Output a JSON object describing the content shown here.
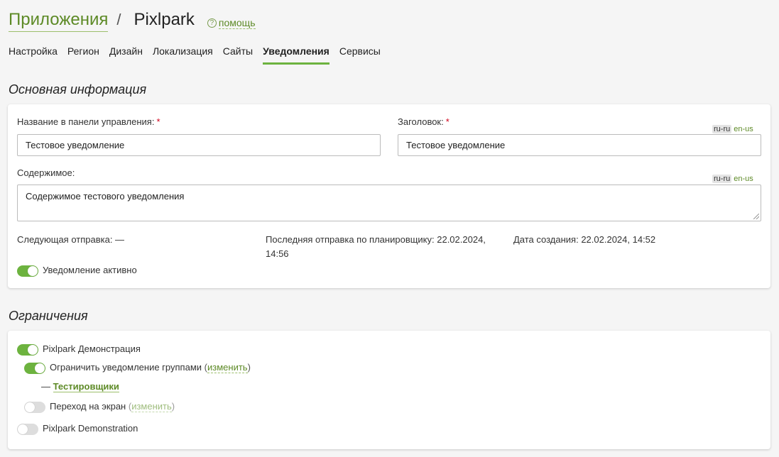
{
  "header": {
    "app_link": "Приложения",
    "separator": "/",
    "current": "Pixlpark",
    "help_icon_glyph": "?",
    "help_label": "помощь"
  },
  "tabs": [
    {
      "label": "Настройка",
      "active": false
    },
    {
      "label": "Регион",
      "active": false
    },
    {
      "label": "Дизайн",
      "active": false
    },
    {
      "label": "Локализация",
      "active": false
    },
    {
      "label": "Сайты",
      "active": false
    },
    {
      "label": "Уведомления",
      "active": true
    },
    {
      "label": "Сервисы",
      "active": false
    }
  ],
  "basic": {
    "section_title": "Основная информация",
    "name_label": "Название в панели управления:",
    "name_value": "Тестовое уведомление",
    "title_label": "Заголовок:",
    "title_value": "Тестовое уведомление",
    "required_mark": "*",
    "content_label": "Содержимое:",
    "content_value": "Содержимое тестового уведомления",
    "locale_active": "ru-ru",
    "locale_other": "en-us",
    "next_send": "Следующая отправка: —",
    "last_sched": "Последняя отправка по планировщику: 22.02.2024, 14:56",
    "created": "Дата создания: 22.02.2024, 14:52",
    "active_toggle_label": "Уведомление активно",
    "active_toggle_on": true
  },
  "limits": {
    "section_title": "Ограничения",
    "demo_label": "Pixlpark Демонстрация",
    "demo_on": true,
    "restrict_groups_label": "Ограничить уведомление группами",
    "restrict_groups_on": true,
    "change_label": "изменить",
    "group_dash": "—",
    "group_name": "Тестировщики",
    "screen_label": "Переход на экран",
    "screen_on": false,
    "demo_en_label": "Pixlpark Demonstration",
    "demo_en_on": false
  },
  "colors": {
    "accent": "#6db33f",
    "link": "#5d8a26",
    "required": "#d0021b",
    "background": "#f5f5f5"
  }
}
